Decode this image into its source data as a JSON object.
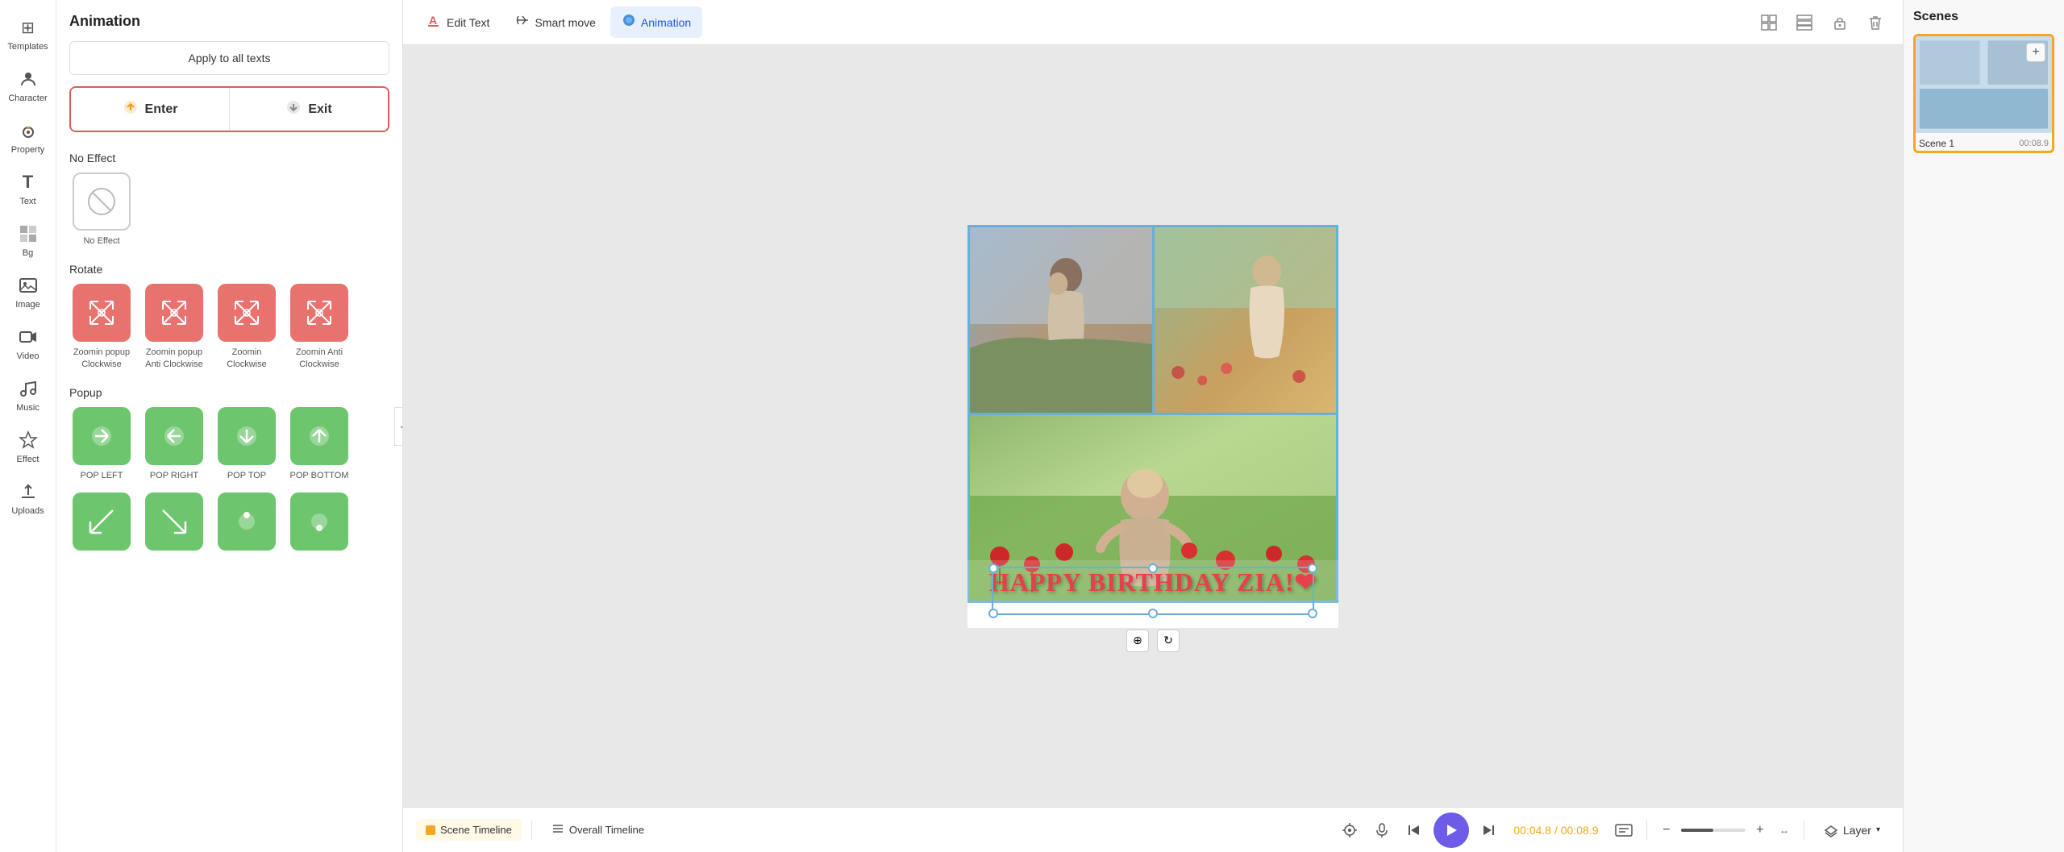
{
  "sidebar": {
    "items": [
      {
        "id": "templates",
        "label": "Templates",
        "icon": "⊞"
      },
      {
        "id": "character",
        "label": "Character",
        "icon": "👤"
      },
      {
        "id": "property",
        "label": "Property",
        "icon": "☕"
      },
      {
        "id": "text",
        "label": "Text",
        "icon": "T"
      },
      {
        "id": "bg",
        "label": "Bg",
        "icon": "▦"
      },
      {
        "id": "image",
        "label": "Image",
        "icon": "🖼"
      },
      {
        "id": "video",
        "label": "Video",
        "icon": "▶"
      },
      {
        "id": "music",
        "label": "Music",
        "icon": "♪"
      },
      {
        "id": "effect",
        "label": "Effect",
        "icon": "✦"
      },
      {
        "id": "uploads",
        "label": "Uploads",
        "icon": "⬆"
      }
    ]
  },
  "animation_panel": {
    "title": "Animation",
    "apply_all_label": "Apply to all texts",
    "tabs": [
      {
        "id": "enter",
        "label": "Enter",
        "icon": "↗"
      },
      {
        "id": "exit",
        "label": "Exit",
        "icon": "↙"
      }
    ],
    "sections": [
      {
        "id": "no_effect",
        "label": "No Effect",
        "items": [
          {
            "id": "no_effect",
            "label": "No Effect",
            "icon": "⊘",
            "type": "outline"
          }
        ]
      },
      {
        "id": "rotate",
        "label": "Rotate",
        "items": [
          {
            "id": "zoomin_popup_cw",
            "label": "Zoomin popup Clockwise",
            "icon": "⤢",
            "type": "red"
          },
          {
            "id": "zoomin_popup_acw",
            "label": "Zoomin popup Anti Clockwise",
            "icon": "⤢",
            "type": "red"
          },
          {
            "id": "zoomin_cw",
            "label": "Zoomin Clockwise",
            "icon": "⤢",
            "type": "red"
          },
          {
            "id": "zoomin_anti_cw",
            "label": "Zoomin Anti Clockwise",
            "icon": "⤢",
            "type": "red"
          }
        ]
      },
      {
        "id": "popup",
        "label": "Popup",
        "items": [
          {
            "id": "pop_left",
            "label": "POP LEFT",
            "icon": "→",
            "type": "green"
          },
          {
            "id": "pop_right",
            "label": "POP RIGHT",
            "icon": "←",
            "type": "green"
          },
          {
            "id": "pop_top",
            "label": "POP TOP",
            "icon": "↓",
            "type": "green"
          },
          {
            "id": "pop_bottom",
            "label": "POP BOTTOM",
            "icon": "↑",
            "type": "green"
          }
        ]
      }
    ]
  },
  "toolbar": {
    "buttons": [
      {
        "id": "edit_text",
        "label": "Edit Text",
        "icon": "T",
        "active": false
      },
      {
        "id": "smart_move",
        "label": "Smart move",
        "icon": "⇄",
        "active": false
      },
      {
        "id": "animation",
        "label": "Animation",
        "icon": "🔵",
        "active": true
      }
    ],
    "right_icons": [
      {
        "id": "grid",
        "icon": "⊞"
      },
      {
        "id": "layout",
        "icon": "⊟"
      },
      {
        "id": "lock",
        "icon": "🔒"
      },
      {
        "id": "delete",
        "icon": "🗑"
      }
    ]
  },
  "canvas": {
    "birthday_text": "HAPPY BIRTHDAY ZIA!❤"
  },
  "scenes": {
    "title": "Scenes",
    "items": [
      {
        "id": "scene1",
        "name": "Scene 1",
        "duration": "00:08.9"
      }
    ],
    "add_label": "+"
  },
  "timeline": {
    "tabs": [
      {
        "id": "scene_timeline",
        "label": "Scene Timeline",
        "active": true
      },
      {
        "id": "overall_timeline",
        "label": "Overall Timeline",
        "active": false
      }
    ],
    "current_time": "00:04.8",
    "total_time": "00:08.9",
    "layer_label": "Layer",
    "zoom_percent": 50
  }
}
